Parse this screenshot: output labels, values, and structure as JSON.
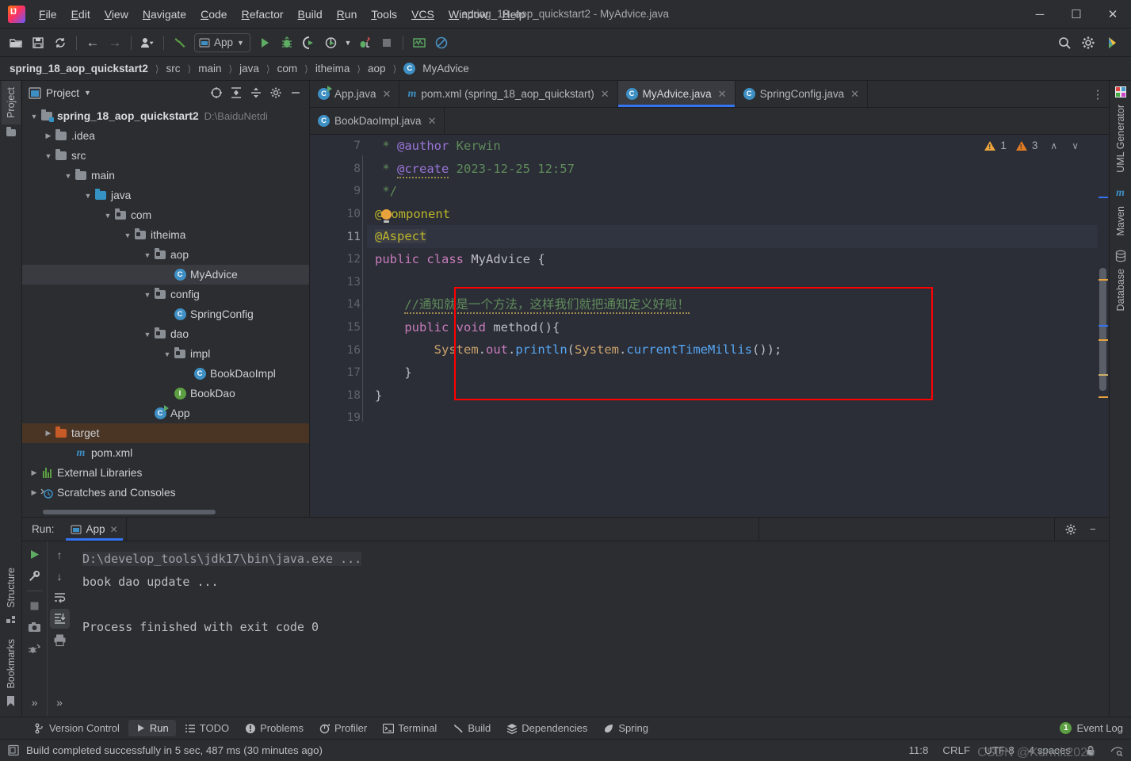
{
  "window": {
    "title": "spring_18_aop_quickstart2 - MyAdvice.java",
    "minimize": "─",
    "maximize": "☐",
    "close": "✕"
  },
  "menu": {
    "items": [
      "File",
      "Edit",
      "View",
      "Navigate",
      "Code",
      "Refactor",
      "Build",
      "Run",
      "Tools",
      "VCS",
      "Window",
      "Help"
    ]
  },
  "toolbar": {
    "open_project": "open-project",
    "save_all": "save-all",
    "sync": "reload-from-disk",
    "back": "←",
    "forward": "→",
    "profile": "profile-selector",
    "build_hammer": "build",
    "run_config": "App",
    "run": "run",
    "debug": "debug",
    "run_coverage": "run-with-coverage",
    "profiler": "profiler",
    "attach": "attach-debugger",
    "stop": "stop",
    "monitor": "services-monitor",
    "disable": "disable-inspection",
    "search": "search-everywhere",
    "settings": "settings",
    "updates": "updates"
  },
  "breadcrumb": {
    "items": [
      "spring_18_aop_quickstart2",
      "src",
      "main",
      "java",
      "com",
      "itheima",
      "aop",
      "MyAdvice"
    ],
    "separator": "〉"
  },
  "left_strip": {
    "project": "Project",
    "structure": "Structure",
    "bookmarks": "Bookmarks"
  },
  "right_strip": {
    "uml": "UML Generator",
    "maven": "Maven",
    "database": "Database"
  },
  "project_panel": {
    "title": "Project",
    "chevron": "▾",
    "actions": [
      "select-opened-file-icon",
      "expand-all-icon",
      "collapse-all-icon",
      "gear-icon",
      "hide-icon"
    ],
    "tree": [
      {
        "label": "spring_18_aop_quickstart2",
        "path": "D:\\BaiduNetdi",
        "indent": 0,
        "arrow": "open",
        "icon": "module",
        "bold": true,
        "state": "normal"
      },
      {
        "label": ".idea",
        "path": "",
        "indent": 1,
        "arrow": "closed",
        "icon": "folder",
        "bold": false,
        "state": "normal"
      },
      {
        "label": "src",
        "path": "",
        "indent": 1,
        "arrow": "open",
        "icon": "folder",
        "bold": false,
        "state": "normal"
      },
      {
        "label": "main",
        "path": "",
        "indent": 2,
        "arrow": "open",
        "icon": "folder",
        "bold": false,
        "state": "normal"
      },
      {
        "label": "java",
        "path": "",
        "indent": 3,
        "arrow": "open",
        "icon": "source-folder",
        "bold": false,
        "state": "normal"
      },
      {
        "label": "com",
        "path": "",
        "indent": 4,
        "arrow": "open",
        "icon": "package",
        "bold": false,
        "state": "normal"
      },
      {
        "label": "itheima",
        "path": "",
        "indent": 5,
        "arrow": "open",
        "icon": "package",
        "bold": false,
        "state": "normal"
      },
      {
        "label": "aop",
        "path": "",
        "indent": 6,
        "arrow": "open",
        "icon": "package",
        "bold": false,
        "state": "normal"
      },
      {
        "label": "MyAdvice",
        "path": "",
        "indent": 7,
        "arrow": "none",
        "icon": "class",
        "bold": false,
        "state": "selected"
      },
      {
        "label": "config",
        "path": "",
        "indent": 6,
        "arrow": "open",
        "icon": "package",
        "bold": false,
        "state": "normal"
      },
      {
        "label": "SpringConfig",
        "path": "",
        "indent": 7,
        "arrow": "none",
        "icon": "class",
        "bold": false,
        "state": "normal"
      },
      {
        "label": "dao",
        "path": "",
        "indent": 6,
        "arrow": "open",
        "icon": "package",
        "bold": false,
        "state": "normal"
      },
      {
        "label": "impl",
        "path": "",
        "indent": 7,
        "arrow": "open",
        "icon": "package",
        "bold": false,
        "state": "normal"
      },
      {
        "label": "BookDaoImpl",
        "path": "",
        "indent": 8,
        "arrow": "none",
        "icon": "class",
        "bold": false,
        "state": "normal"
      },
      {
        "label": "BookDao",
        "path": "",
        "indent": 7,
        "arrow": "none",
        "icon": "interface",
        "bold": false,
        "state": "normal"
      },
      {
        "label": "App",
        "path": "",
        "indent": 6,
        "arrow": "none",
        "icon": "runnable-class",
        "bold": false,
        "state": "normal"
      },
      {
        "label": "target",
        "path": "",
        "indent": 1,
        "arrow": "closed",
        "icon": "excluded-folder",
        "bold": false,
        "state": "target"
      },
      {
        "label": "pom.xml",
        "path": "",
        "indent": 2,
        "arrow": "none",
        "icon": "maven-file",
        "bold": false,
        "state": "normal"
      },
      {
        "label": "External Libraries",
        "path": "",
        "indent": 0,
        "arrow": "closed",
        "icon": "libraries",
        "bold": false,
        "state": "normal"
      },
      {
        "label": "Scratches and Consoles",
        "path": "",
        "indent": 0,
        "arrow": "closed",
        "icon": "scratches",
        "bold": false,
        "state": "normal"
      }
    ]
  },
  "editor": {
    "tabs_row1": [
      {
        "label": "App.java",
        "icon": "runnable-class",
        "active": false
      },
      {
        "label": "pom.xml (spring_18_aop_quickstart)",
        "icon": "maven-file",
        "active": false
      },
      {
        "label": "MyAdvice.java",
        "icon": "class",
        "active": true
      },
      {
        "label": "SpringConfig.java",
        "icon": "class",
        "active": false
      }
    ],
    "tabs_row2": [
      {
        "label": "BookDaoImpl.java",
        "icon": "class",
        "active": false
      }
    ],
    "kebab": "⋮",
    "inspections": {
      "warnings_light": "1",
      "warnings_strong": "3",
      "up": "∧",
      "down": "∨"
    },
    "first_line_number": 7,
    "lines": [
      {
        "n": 7,
        "text": "* @author Kerwin",
        "kind": "javadoc",
        "cut": true
      },
      {
        "n": 8,
        "text": " * @create 2023-12-25 12:57",
        "kind": "javadoc"
      },
      {
        "n": 9,
        "text": " */",
        "kind": "javadoc"
      },
      {
        "n": 10,
        "text": "@Component",
        "kind": "annotation"
      },
      {
        "n": 11,
        "text": "@Aspect",
        "kind": "annotation",
        "current": true
      },
      {
        "n": 12,
        "text": "public class MyAdvice {",
        "kind": "classdecl"
      },
      {
        "n": 13,
        "text": "",
        "kind": "blank"
      },
      {
        "n": 14,
        "text": "    //通知就是一个方法，这样我们就把通知定义好啦！",
        "kind": "comment"
      },
      {
        "n": 15,
        "text": "    public void method(){",
        "kind": "method"
      },
      {
        "n": 16,
        "text": "        System.out.println(System.currentTimeMillis());",
        "kind": "stmt"
      },
      {
        "n": 17,
        "text": "    }",
        "kind": "brace"
      },
      {
        "n": 18,
        "text": "}",
        "kind": "brace"
      },
      {
        "n": 19,
        "text": "",
        "kind": "blank"
      }
    ]
  },
  "run_panel": {
    "label": "Run:",
    "tab": "App",
    "tab_close": "✕",
    "tools_left": [
      "rerun-icon",
      "wrench-icon",
      "stop-icon",
      "camera-icon",
      "dump-threads-icon",
      "more-icon"
    ],
    "tools_right": [
      "up-arrow-icon",
      "down-arrow-icon",
      "soft-wrap-icon",
      "scroll-to-end-icon",
      "print-icon",
      "more-icon"
    ],
    "settings_icon": "gear-icon",
    "hide_icon": "hide-icon",
    "console_lines": [
      {
        "text": "D:\\develop_tools\\jdk17\\bin\\java.exe ...",
        "dim": true
      },
      {
        "text": "book dao update ...",
        "dim": false
      },
      {
        "text": "",
        "dim": false
      },
      {
        "text": "Process finished with exit code 0",
        "dim": false
      }
    ]
  },
  "status_tools": [
    {
      "label": "Version Control",
      "icon": "branch-icon",
      "active": false
    },
    {
      "label": "Run",
      "icon": "run-icon",
      "active": true
    },
    {
      "label": "TODO",
      "icon": "todo-icon",
      "active": false
    },
    {
      "label": "Problems",
      "icon": "problems-icon",
      "active": false
    },
    {
      "label": "Profiler",
      "icon": "profiler-icon",
      "active": false
    },
    {
      "label": "Terminal",
      "icon": "terminal-icon",
      "active": false
    },
    {
      "label": "Build",
      "icon": "build-icon",
      "active": false
    },
    {
      "label": "Dependencies",
      "icon": "dependencies-icon",
      "active": false
    },
    {
      "label": "Spring",
      "icon": "spring-icon",
      "active": false
    }
  ],
  "event_log": {
    "count": "1",
    "label": "Event Log"
  },
  "status_bar": {
    "message": "Build completed successfully in 5 sec, 487 ms (30 minutes ago)",
    "caret": "11:8",
    "line_sep": "CRLF",
    "encoding": "UTF-8",
    "indent": "4 spaces",
    "lock_icon": "lock-icon",
    "inspection_icon": "inspection-icon"
  },
  "watermark": "CSDN @Kermit2023",
  "colors": {
    "accent": "#3574F0",
    "highlight_box": "#FF0000",
    "comment_green": "#5F8C5A",
    "keyword": "#C77DBB",
    "annotation": "#BBB529",
    "target_folder": "#4A3525",
    "warn": "#E8A33D"
  }
}
